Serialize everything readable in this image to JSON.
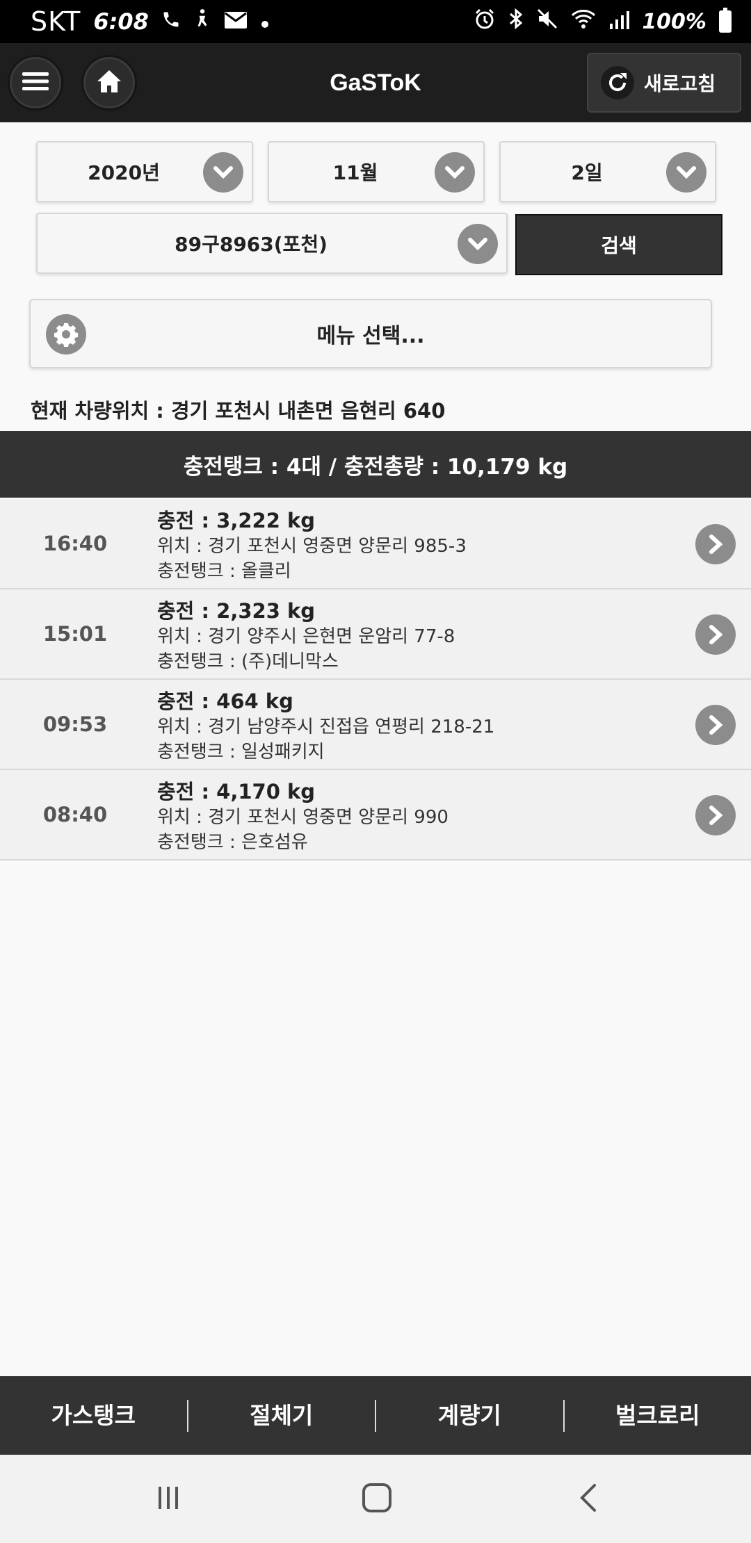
{
  "status_bar": {
    "carrier": "SKT",
    "time": "6:08",
    "battery": "100%"
  },
  "header": {
    "title": "GaSToK",
    "refresh_label": "새로고침"
  },
  "filters": {
    "year": "2020년",
    "month": "11월",
    "day": "2일",
    "vehicle": "89구8963(포천)",
    "search_label": "검색",
    "menu_label": "메뉴 선택..."
  },
  "location": "현재 차량위치 : 경기 포천시 내촌면 음현리 640",
  "summary": "충전탱크 : 4대  /  충전총량 : 10,179 kg",
  "records": [
    {
      "time": "16:40",
      "charge": "충전 : 3,222 kg",
      "location": "위치 : 경기 포천시 영중면 양문리 985-3",
      "tank": "충전탱크 : 올클리"
    },
    {
      "time": "15:01",
      "charge": "충전 : 2,323 kg",
      "location": "위치 : 경기 양주시 은현면 운암리 77-8",
      "tank": "충전탱크 : (주)데니막스"
    },
    {
      "time": "09:53",
      "charge": "충전 : 464 kg",
      "location": "위치 : 경기 남양주시 진접읍 연평리 218-21",
      "tank": "충전탱크 : 일성패키지"
    },
    {
      "time": "08:40",
      "charge": "충전 : 4,170 kg",
      "location": "위치 : 경기 포천시 영중면 양문리 990",
      "tank": "충전탱크 : 은호섬유"
    }
  ],
  "bottom_nav": {
    "items": [
      "가스탱크",
      "절체기",
      "계량기",
      "벌크로리"
    ]
  },
  "colors": {
    "header_bg": "#1e1e1e",
    "dark_bar": "#333333",
    "icon_circle": "#8c8c8c",
    "page_bg": "#f9f9f9"
  }
}
